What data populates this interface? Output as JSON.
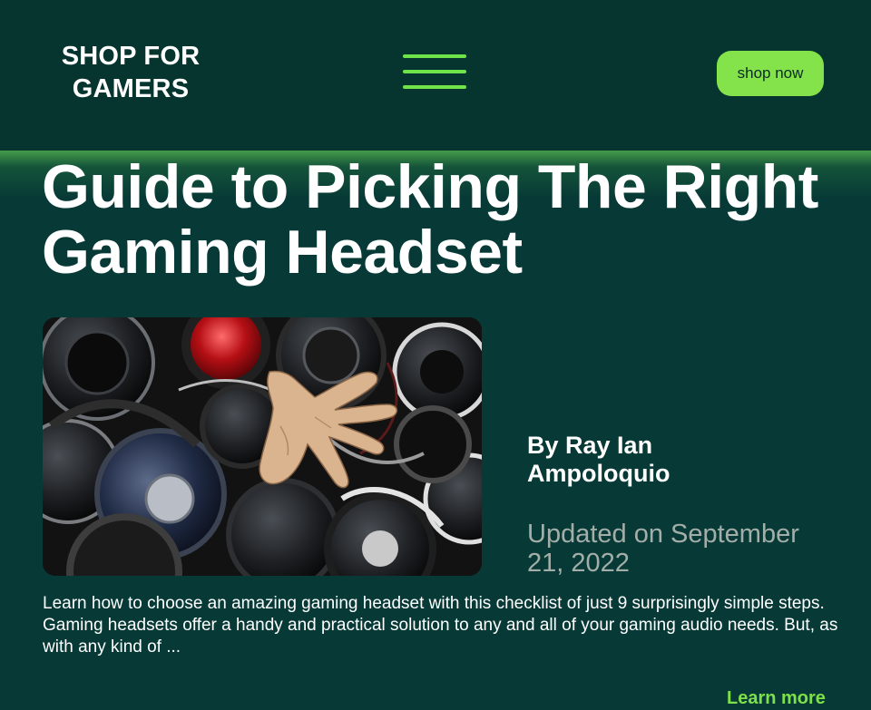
{
  "header": {
    "brand_line1": "SHOP FOR",
    "brand_line2": "GAMERS",
    "menu_icon": "hamburger-icon",
    "shop_button": "shop now"
  },
  "article": {
    "title_line1": "Guide to Picking The Right",
    "title_line2": "Gaming Headset",
    "image_subject": "pile of headphones with a reaching hand",
    "author_line1": "By Ray Ian",
    "author_line2": "Ampoloquio",
    "updated_line1": "Updated on September",
    "updated_line2": "21, 2022",
    "excerpt_p1": "Learn how to choose an amazing gaming headset with this checklist of just 9 surprisingly simple steps.",
    "excerpt_p2": "Gaming headsets offer a handy and practical solution to any and all of your gaming audio needs. But, as with any kind of ...",
    "learn_more": "Learn more"
  },
  "colors": {
    "background": "#073a36",
    "header_background": "#063530",
    "accent_green": "#84e24a",
    "link_green": "#7ee04a",
    "muted_text": "#a4aea9"
  }
}
